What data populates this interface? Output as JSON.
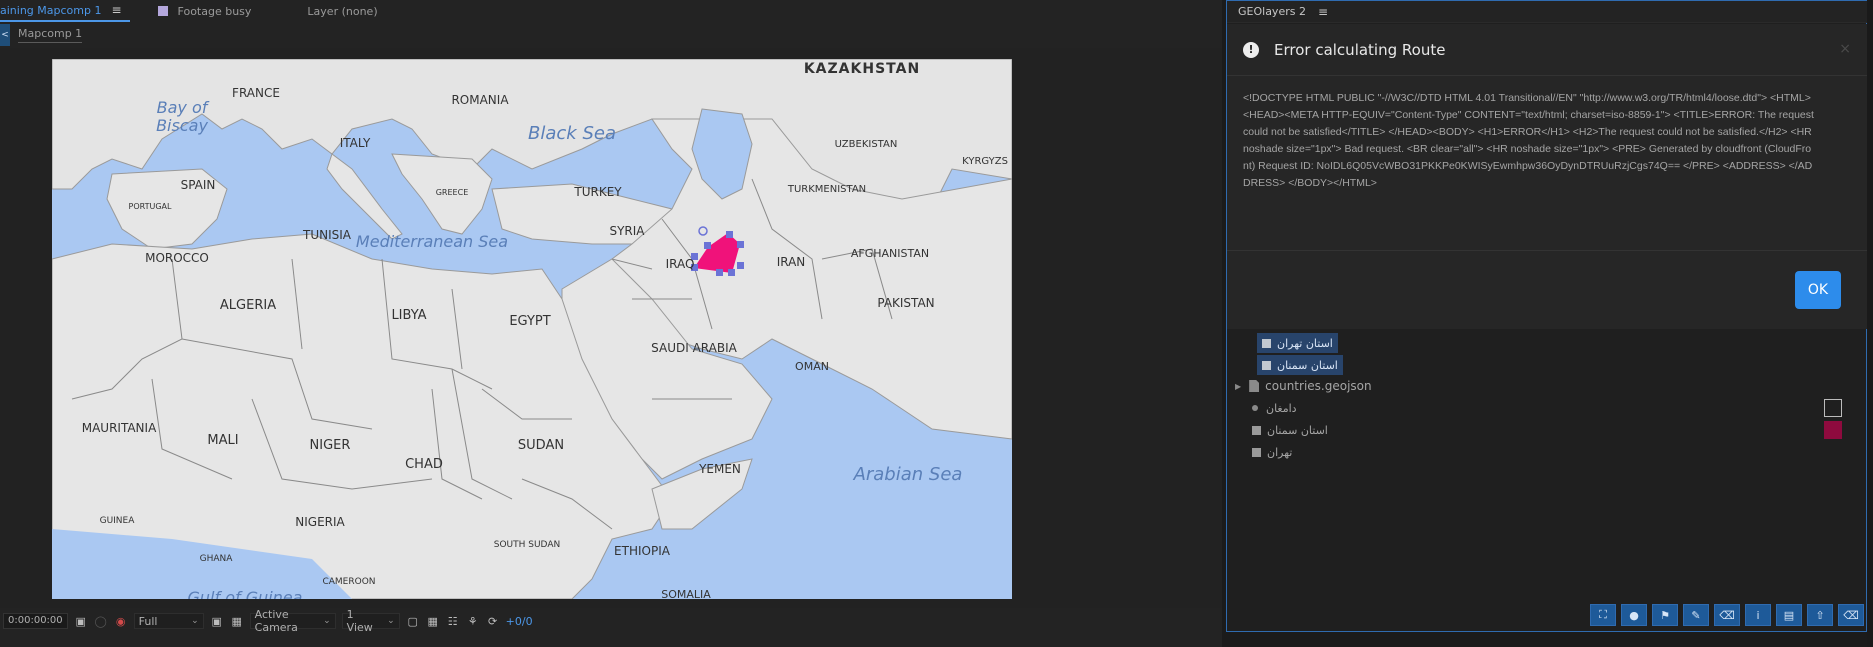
{
  "comp_panel": {
    "tabs": [
      {
        "label": "aining Mapcomp 1",
        "menu": "≡"
      },
      {
        "label": "Footage busy"
      },
      {
        "label": "Layer (none)"
      }
    ],
    "breadcrumb": "Mapcomp 1",
    "map_labels": {
      "kazakhstan": "KAZAKHSTAN",
      "bay_of_biscay_1": "Bay of",
      "bay_of_biscay_2": "Biscay",
      "france": "FRANCE",
      "romania": "ROMANIA",
      "black_sea": "Black Sea",
      "uzbekistan": "UZBEKISTAN",
      "kyrgyzstan": "KYRGYZS",
      "italy": "ITALY",
      "spain": "SPAIN",
      "greece": "GREECE",
      "turkey": "TURKEY",
      "turkmenistan": "TURKMENISTAN",
      "portugal": "PORTUGAL",
      "tunisia": "TUNISIA",
      "mediterranean": "Mediterranean Sea",
      "syria": "SYRIA",
      "iraq": "IRAQ",
      "iran": "IRAN",
      "afghanistan": "AFGHANISTAN",
      "morocco": "MOROCCO",
      "algeria": "ALGERIA",
      "libya": "LIBYA",
      "egypt": "EGYPT",
      "pakistan": "PAKISTAN",
      "saudi_arabia": "SAUDI ARABIA",
      "mauritania": "MAURITANIA",
      "oman": "OMAN",
      "mali": "MALI",
      "niger": "NIGER",
      "chad": "CHAD",
      "sudan": "SUDAN",
      "yemen": "YEMEN",
      "arabian_sea": "Arabian Sea",
      "nigeria": "NIGERIA",
      "guinea": "GUINEA",
      "south_sudan": "SOUTH SUDAN",
      "ethiopia": "ETHIOPIA",
      "ghana": "GHANA",
      "cameroon": "CAMEROON",
      "gulf_of_guinea": "Gulf of Guinea",
      "somalia": "SOMALIA"
    },
    "bottom_bar": {
      "timecode": "0:00:00:00",
      "resolution": "Full",
      "camera": "Active Camera",
      "views": "1 View",
      "exposure": "+0/0"
    }
  },
  "geo_panel": {
    "title": "GEOlayers 2",
    "menu": "≡",
    "dialog": {
      "title": "Error calculating Route",
      "close": "×",
      "message": "<!DOCTYPE HTML PUBLIC \"-//W3C//DTD HTML 4.01 Transitional//EN\" \"http://www.w3.org/TR/html4/loose.dtd\"> <HTML><HEAD><META HTTP-EQUIV=\"Content-Type\" CONTENT=\"text/html; charset=iso-8859-1\"> <TITLE>ERROR: The request could not be satisfied</TITLE> </HEAD><BODY> <H1>ERROR</H1> <H2>The request could not be satisfied.</H2> <HR noshade size=\"1px\"> Bad request. <BR clear=\"all\"> <HR noshade size=\"1px\"> <PRE> Generated by cloudfront (CloudFront) Request ID: NoIDL6Q05VcWBO31PKKPe0KWISyEwmhpw36OyDynDTRUuRzjCgs74Q== </PRE> <ADDRESS> </ADDRESS> </BODY></HTML>",
      "ok_label": "OK"
    },
    "layers": {
      "selected_1": "استان تهران",
      "selected_2": "استان سمنان",
      "file": "countries.geojson",
      "row_1": "دامغان",
      "row_2": "استان سمنان",
      "row_3": "تهران"
    },
    "toolbar_icons": [
      "expand-icon",
      "pin-icon",
      "tag-icon",
      "pen-icon",
      "eraser-icon",
      "info-icon",
      "folder-icon",
      "export-icon",
      "trash-icon"
    ]
  },
  "colors": {
    "accent": "#2d8ceb",
    "active_tab": "#4c97e8",
    "route_shape": "#f0127a",
    "selection_handle": "#6b73d6",
    "layer_color": "#8e0a3e"
  }
}
